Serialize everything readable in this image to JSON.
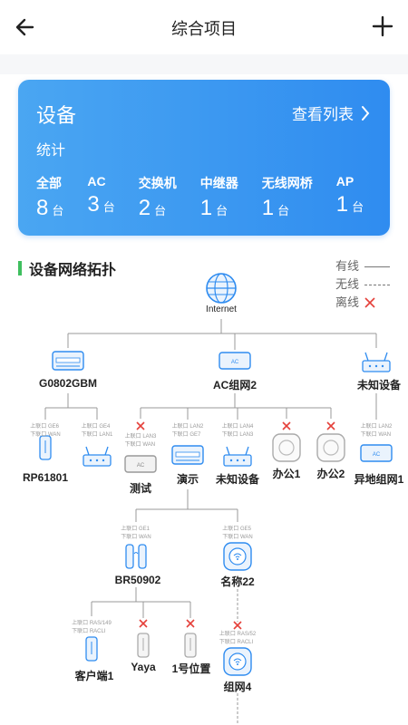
{
  "header": {
    "title": "综合项目"
  },
  "device_card": {
    "title": "设备",
    "view_list": "查看列表",
    "stats_label": "统计",
    "unit": "台",
    "categories": [
      {
        "label": "全部",
        "count": "8"
      },
      {
        "label": "AC",
        "count": "3"
      },
      {
        "label": "交换机",
        "count": "2"
      },
      {
        "label": "中继器",
        "count": "1"
      },
      {
        "label": "无线网桥",
        "count": "1"
      },
      {
        "label": "AP",
        "count": "1"
      }
    ]
  },
  "topology": {
    "title": "设备网络拓扑",
    "legend": {
      "wired": "有线",
      "wireless": "无线",
      "offline": "离线"
    },
    "root": "Internet",
    "level1": {
      "g0802gbm": "G0802GBM",
      "ac_group2": "AC组网2",
      "unknown": "未知设备"
    },
    "level2": {
      "rp61801": "RP61801",
      "test": "测试",
      "demo": "演示",
      "unknown2": "未知设备",
      "office1": "办公1",
      "office2": "办公2",
      "remote_group1": "异地组网1"
    },
    "level3": {
      "br50902": "BR50902",
      "name22": "名称22"
    },
    "level4": {
      "client1": "客户端1",
      "yaya": "Yaya",
      "pos1": "1号位置",
      "group4": "组网4"
    },
    "ports": {
      "rp61801": [
        "上联口 GE6",
        "下联口 WAN"
      ],
      "g0802_child2": [
        "上联口 GE4",
        "下联口 LAN1"
      ],
      "test": [
        "上联口 LAN3",
        "下联口 WAN"
      ],
      "demo": [
        "上联口 LAN2",
        "下联口 GE7"
      ],
      "unknown2": [
        "上联口 LAN4",
        "下联口 LAN3"
      ],
      "remote_group1": [
        "上联口 LAN2",
        "下联口 WAN"
      ],
      "br50902": [
        "上联口 GE1",
        "下联口 WAN"
      ],
      "name22": [
        "上联口 GE5",
        "下联口 WAN"
      ],
      "client1": [
        "上联口 RAS/149",
        "下联口 RACLI"
      ],
      "group4": [
        "上联口 RAS/52",
        "下联口 RACLI"
      ]
    }
  }
}
